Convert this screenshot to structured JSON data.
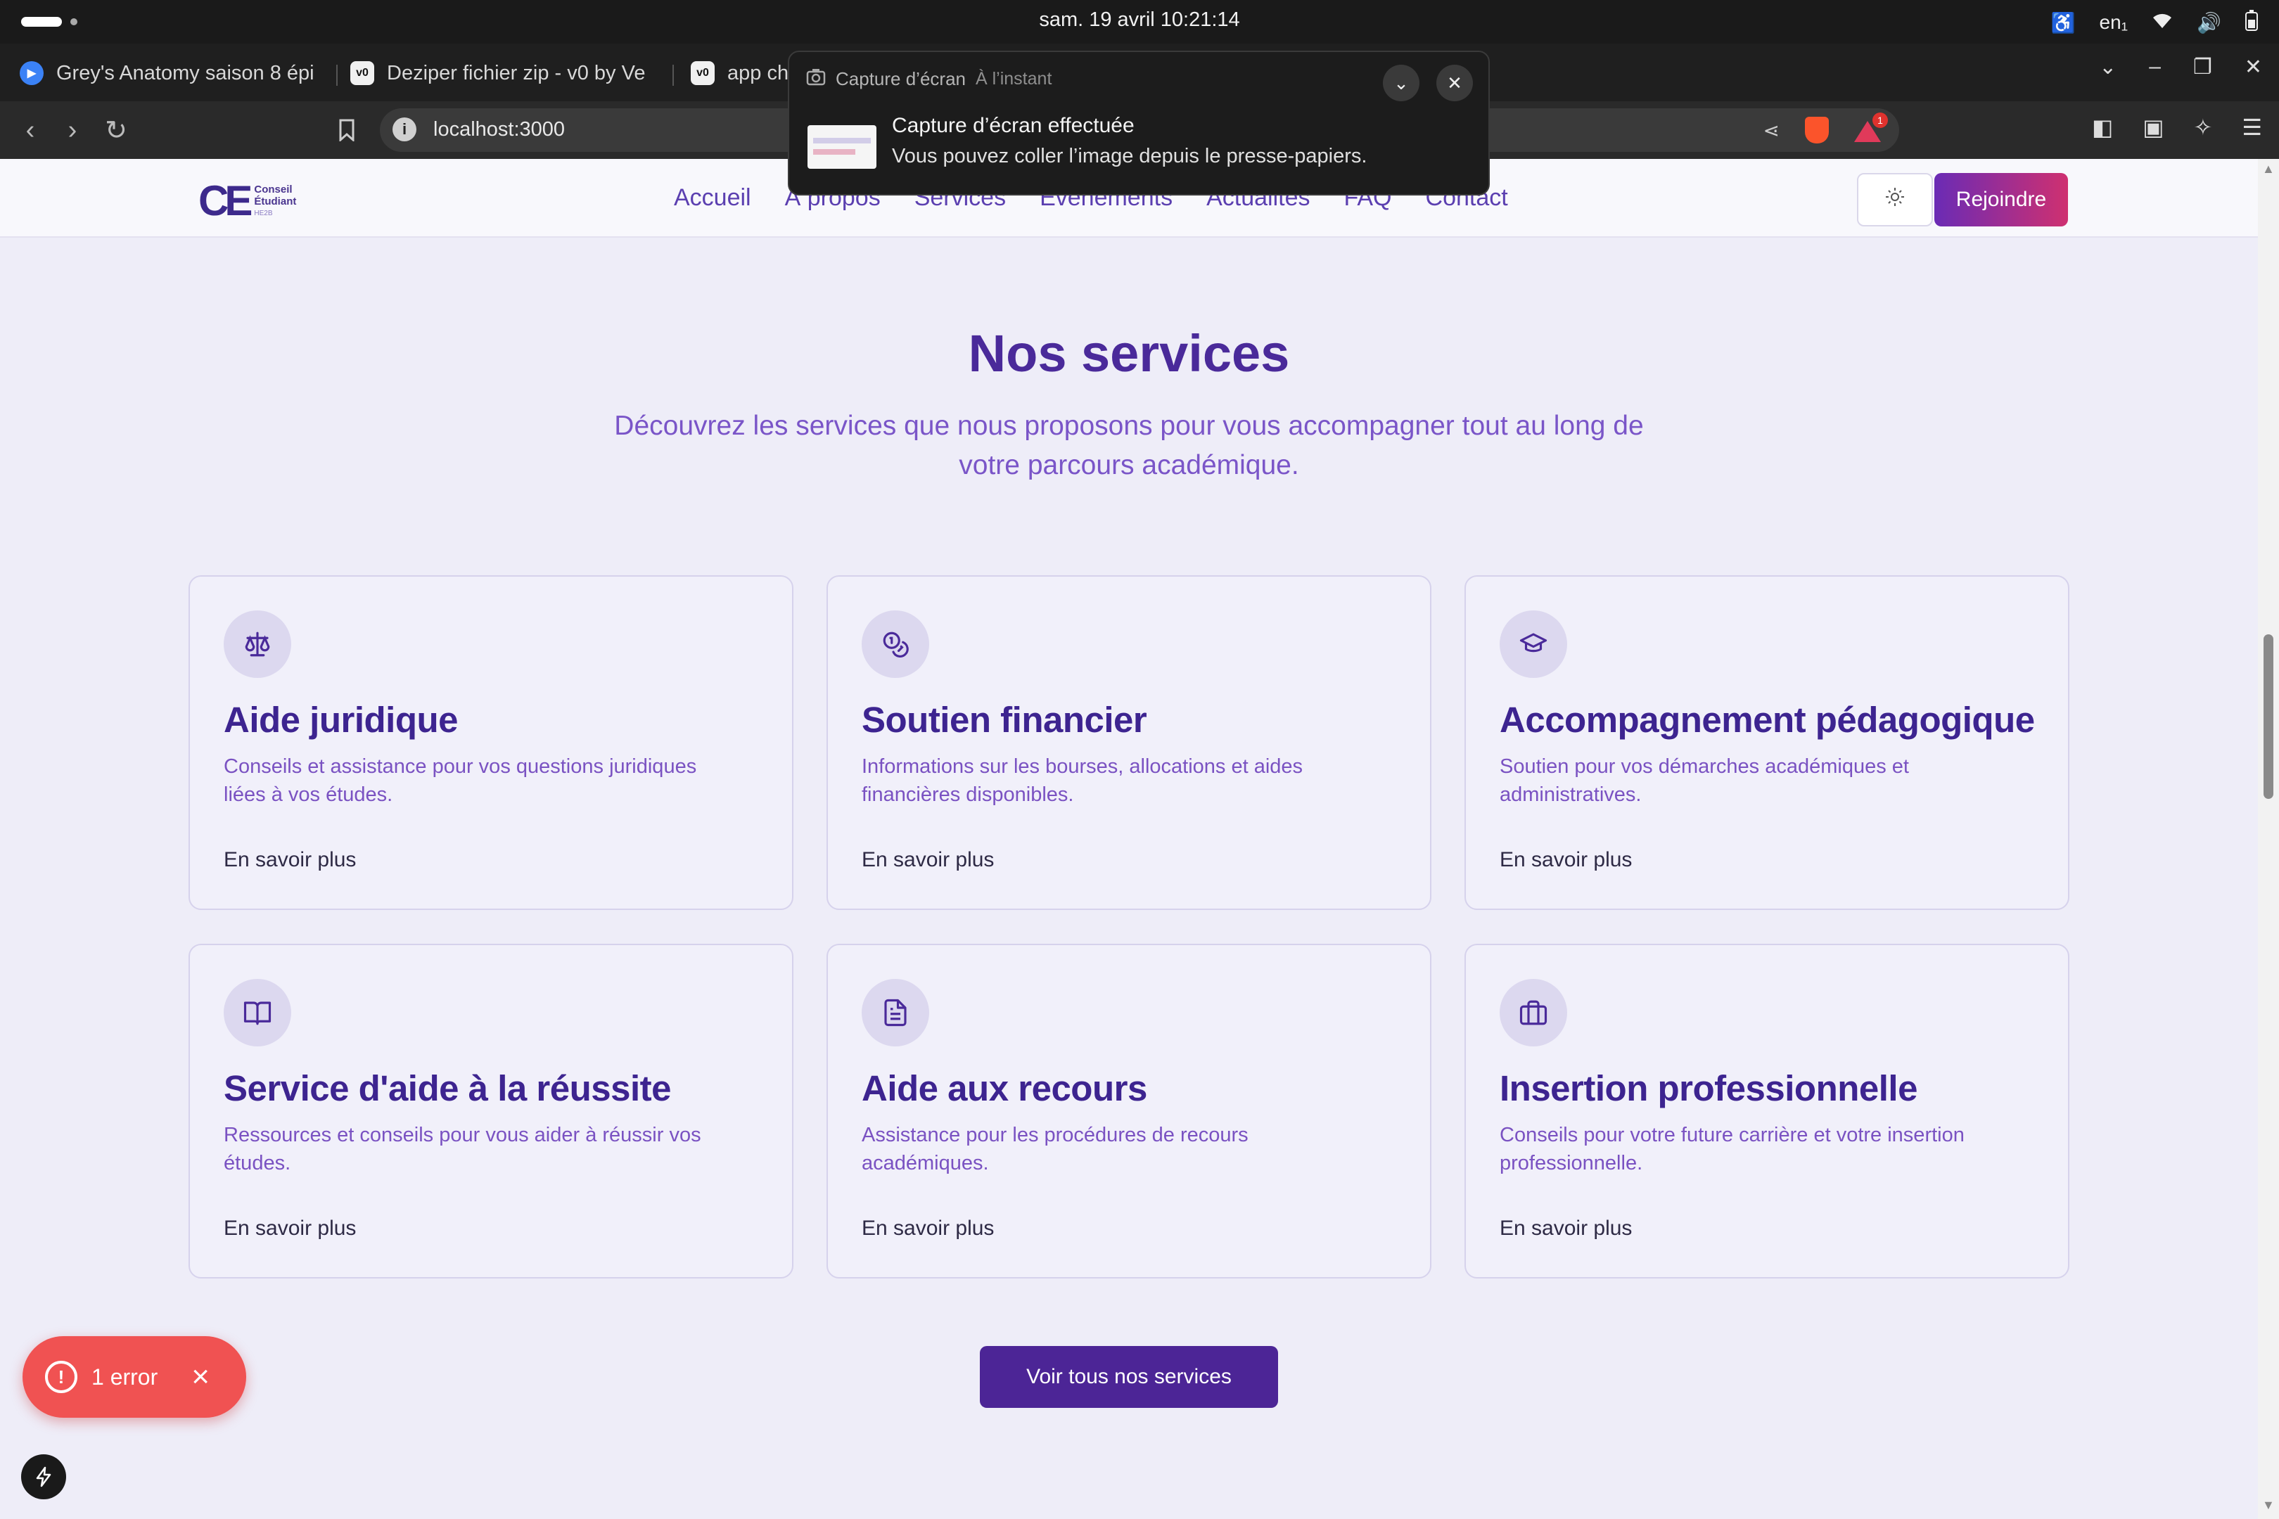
{
  "system": {
    "clock": "sam. 19 avril  10:21:14",
    "lang": "en₁"
  },
  "tabs": [
    {
      "title": "Grey's Anatomy saison 8 épi",
      "icon": "play-icon"
    },
    {
      "title": "Deziper fichier zip - v0 by Ve",
      "icon": "v0-icon"
    },
    {
      "title": "app ch",
      "icon": "v0-icon"
    }
  ],
  "browser": {
    "url": "localhost:3000"
  },
  "notification": {
    "app": "Capture d’écran",
    "time": "À l’instant",
    "title": "Capture d’écran effectuée",
    "body": "Vous pouvez coller l’image depuis le presse-papiers."
  },
  "site": {
    "logo": {
      "mark": "CE",
      "line1": "Conseil",
      "line2": "Étudiant",
      "line3": "HE2B"
    },
    "nav": [
      "Accueil",
      "À propos",
      "Services",
      "Événements",
      "Actualités",
      "FAQ",
      "Contact"
    ],
    "join_label": "Rejoindre"
  },
  "services": {
    "title": "Nos services",
    "subtitle": "Découvrez les services que nous proposons pour vous accompagner tout au long de votre parcours académique.",
    "cards": [
      {
        "icon": "scale-icon",
        "title": "Aide juridique",
        "desc": "Conseils et assistance pour vos questions juridiques liées à vos études.",
        "link": "En savoir plus"
      },
      {
        "icon": "coins-icon",
        "title": "Soutien financier",
        "desc": "Informations sur les bourses, allocations et aides financières disponibles.",
        "link": "En savoir plus"
      },
      {
        "icon": "graduation-cap-icon",
        "title": "Accompagnement pédagogique",
        "desc": "Soutien pour vos démarches académiques et administratives.",
        "link": "En savoir plus"
      },
      {
        "icon": "book-open-icon",
        "title": "Service d'aide à la réussite",
        "desc": "Ressources et conseils pour vous aider à réussir vos études.",
        "link": "En savoir plus"
      },
      {
        "icon": "file-text-icon",
        "title": "Aide aux recours",
        "desc": "Assistance pour les procédures de recours académiques.",
        "link": "En savoir plus"
      },
      {
        "icon": "briefcase-icon",
        "title": "Insertion professionnelle",
        "desc": "Conseils pour votre future carrière et votre insertion professionnelle.",
        "link": "En savoir plus"
      }
    ],
    "all_label": "Voir tous nos services"
  },
  "devtools": {
    "error_label": "1 error"
  },
  "colors": {
    "brand": "#4c2596",
    "accent": "#cf3070",
    "error": "#f05252"
  }
}
